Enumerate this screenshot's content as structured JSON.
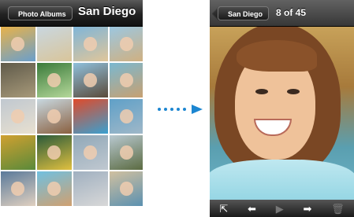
{
  "left_screen": {
    "back_button": "Photo Albums",
    "title": "San Diego",
    "thumbnails": [
      {
        "c1": "#e8b24a",
        "c2": "#6a9fcc",
        "faces": true
      },
      {
        "c1": "#c9d7e0",
        "c2": "#d9c59a",
        "faces": false
      },
      {
        "c1": "#7fb5d8",
        "c2": "#e0c69a",
        "faces": true
      },
      {
        "c1": "#9cc7e0",
        "c2": "#d0b080",
        "faces": true
      },
      {
        "c1": "#5f5a4a",
        "c2": "#a89a7a",
        "faces": false
      },
      {
        "c1": "#3a7a3a",
        "c2": "#b5d89a",
        "faces": true
      },
      {
        "c1": "#8fc0dc",
        "c2": "#5a4a3a",
        "faces": true
      },
      {
        "c1": "#7ab8d0",
        "c2": "#c8a070",
        "faces": true
      },
      {
        "c1": "#c0c8d0",
        "c2": "#e8e0d0",
        "faces": true
      },
      {
        "c1": "#c8d8e0",
        "c2": "#8a6040",
        "faces": true
      },
      {
        "c1": "#e04a2a",
        "c2": "#3aa0d0",
        "faces": false
      },
      {
        "c1": "#5fa0c8",
        "c2": "#a0b8c8",
        "faces": true
      },
      {
        "c1": "#d0a030",
        "c2": "#5a8a3a",
        "faces": false
      },
      {
        "c1": "#2a5a3a",
        "c2": "#e0c040",
        "faces": true
      },
      {
        "c1": "#90a8b8",
        "c2": "#c0c8d0",
        "faces": true
      },
      {
        "c1": "#b8c8d0",
        "c2": "#5a6a40",
        "faces": true
      },
      {
        "c1": "#5a7a9a",
        "c2": "#e0d0c0",
        "faces": true
      },
      {
        "c1": "#70c0e0",
        "c2": "#d0a070",
        "faces": true
      },
      {
        "c1": "#a0b0c0",
        "c2": "#d8d8d8",
        "faces": false
      },
      {
        "c1": "#d0c0a0",
        "c2": "#5a90b0",
        "faces": true
      }
    ]
  },
  "right_screen": {
    "back_button": "San Diego",
    "counter": "8 of 45"
  },
  "toolbar": {
    "icons": [
      "share-icon",
      "arrow-left-icon",
      "play-icon",
      "arrow-right-icon",
      "trash-icon"
    ]
  },
  "colors": {
    "accent": "#1c86d1"
  }
}
